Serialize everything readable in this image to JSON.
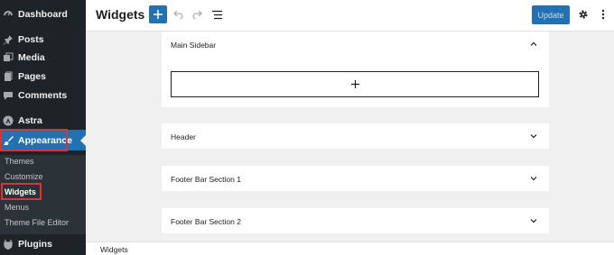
{
  "sidebar": {
    "items": [
      {
        "label": "Dashboard",
        "icon": "dashboard-icon"
      },
      {
        "label": "Posts",
        "icon": "pin-icon"
      },
      {
        "label": "Media",
        "icon": "media-icon"
      },
      {
        "label": "Pages",
        "icon": "pages-icon"
      },
      {
        "label": "Comments",
        "icon": "comments-icon"
      },
      {
        "label": "Astra",
        "icon": "astra-icon"
      },
      {
        "label": "Appearance",
        "icon": "brush-icon"
      },
      {
        "label": "Plugins",
        "icon": "plugins-icon"
      }
    ],
    "submenu": [
      "Themes",
      "Customize",
      "Widgets",
      "Menus",
      "Theme File Editor"
    ],
    "active_color": "#2271b1",
    "highlight_color": "#d63638"
  },
  "header": {
    "title": "Widgets",
    "update_label": "Update"
  },
  "panels": [
    {
      "title": "Main Sidebar",
      "expanded": true
    },
    {
      "title": "Header",
      "expanded": false
    },
    {
      "title": "Footer Bar Section 1",
      "expanded": false
    },
    {
      "title": "Footer Bar Section 2",
      "expanded": false
    }
  ],
  "footer": {
    "breadcrumb": "Widgets"
  }
}
